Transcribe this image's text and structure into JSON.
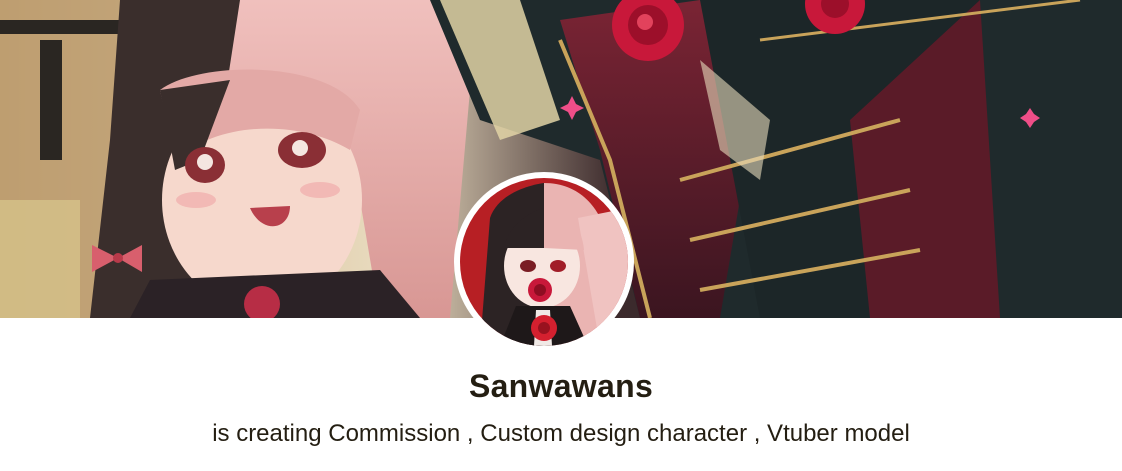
{
  "creator": {
    "name": "Sanwawans",
    "tagline": "is creating Commission , Custom design character , Vtuber model"
  },
  "colors": {
    "text": "#241e12",
    "background": "#ffffff",
    "avatar_border": "#ffffff",
    "rose": "#c8183a",
    "pink_hair": "#eab4b2",
    "dark_hair": "#2c2324",
    "uniform": "#1f2a2c",
    "gold": "#c9a35a"
  },
  "images": {
    "banner": "anime-illustration-banner",
    "avatar": "anime-character-avatar"
  }
}
